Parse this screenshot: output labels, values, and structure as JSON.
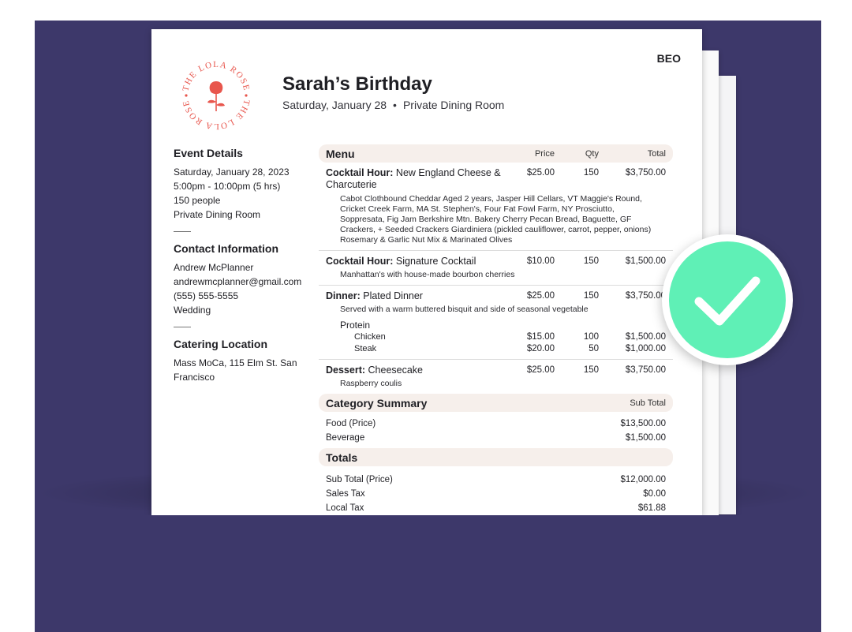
{
  "doc": {
    "tag": "BEO",
    "title": "Sarah’s Birthday",
    "subtitle_date": "Saturday, January 28",
    "subtitle_dot": "•",
    "subtitle_room": "Private Dining Room",
    "logo_text": "THE LOLA ROSE"
  },
  "event_details": {
    "heading": "Event Details",
    "lines": [
      "Saturday, January 28, 2023",
      "5:00pm - 10:00pm (5 hrs)",
      "150 people",
      "Private Dining Room"
    ]
  },
  "contact": {
    "heading": "Contact Information",
    "lines": [
      "Andrew McPlanner",
      "andrewmcplanner@gmail.com",
      "(555) 555-5555",
      "Wedding"
    ]
  },
  "catering": {
    "heading": "Catering Location",
    "lines": [
      "Mass MoCa, 115 Elm St. San",
      "Francisco"
    ]
  },
  "menu": {
    "heading": "Menu",
    "col_price": "Price",
    "col_qty": "Qty",
    "col_total": "Total",
    "items": [
      {
        "label": "Cocktail Hour:",
        "name": "New England Cheese & Charcuterie",
        "price": "$25.00",
        "qty": "150",
        "total": "$3,750.00",
        "desc": "Cabot Clothbound Cheddar Aged 2 years, Jasper Hill Cellars, VT Maggie's Round, Cricket Creek Farm, MA St. Stephen's, Four Fat Fowl Farm, NY Prosciutto, Soppresata, Fig Jam Berkshire Mtn. Bakery Cherry Pecan Bread, Baguette, GF Crackers, + Seeded Crackers Giardiniera (pickled cauliflower, carrot, pepper, onions) Rosemary & Garlic Nut Mix & Marinated Olives"
      },
      {
        "label": "Cocktail Hour:",
        "name": "Signature Cocktail",
        "price": "$10.00",
        "qty": "150",
        "total": "$1,500.00",
        "desc": "Manhattan's with house-made bourbon cherries"
      },
      {
        "label": "Dinner:",
        "name": "Plated Dinner",
        "price": "$25.00",
        "qty": "150",
        "total": "$3,750.00",
        "desc": "Served with a warm buttered bisquit and side of seasonal vegetable",
        "protein_label": "Protein",
        "sub": [
          {
            "name": "Chicken",
            "price": "$15.00",
            "qty": "100",
            "total": "$1,500.00"
          },
          {
            "name": "Steak",
            "price": "$20.00",
            "qty": "50",
            "total": "$1,000.00"
          }
        ]
      },
      {
        "label": "Dessert:",
        "name": "Cheesecake",
        "price": "$25.00",
        "qty": "150",
        "total": "$3,750.00",
        "desc": "Raspberry coulis"
      }
    ]
  },
  "category_summary": {
    "heading": "Category Summary",
    "col": "Sub Total",
    "rows": [
      {
        "name": "Food (Price)",
        "value": "$13,500.00"
      },
      {
        "name": "Beverage",
        "value": "$1,500.00"
      }
    ]
  },
  "totals": {
    "heading": "Totals",
    "rows": [
      {
        "name": "Sub Total (Price)",
        "value": "$12,000.00"
      },
      {
        "name": "Sales Tax",
        "value": "$0.00"
      },
      {
        "name": "Local Tax",
        "value": "$61.88"
      }
    ]
  },
  "colors": {
    "frame": "#3d386a",
    "accent_rose": "#e8564d",
    "check_green": "#5ff0b6",
    "section_bar": "#f6efeb"
  }
}
